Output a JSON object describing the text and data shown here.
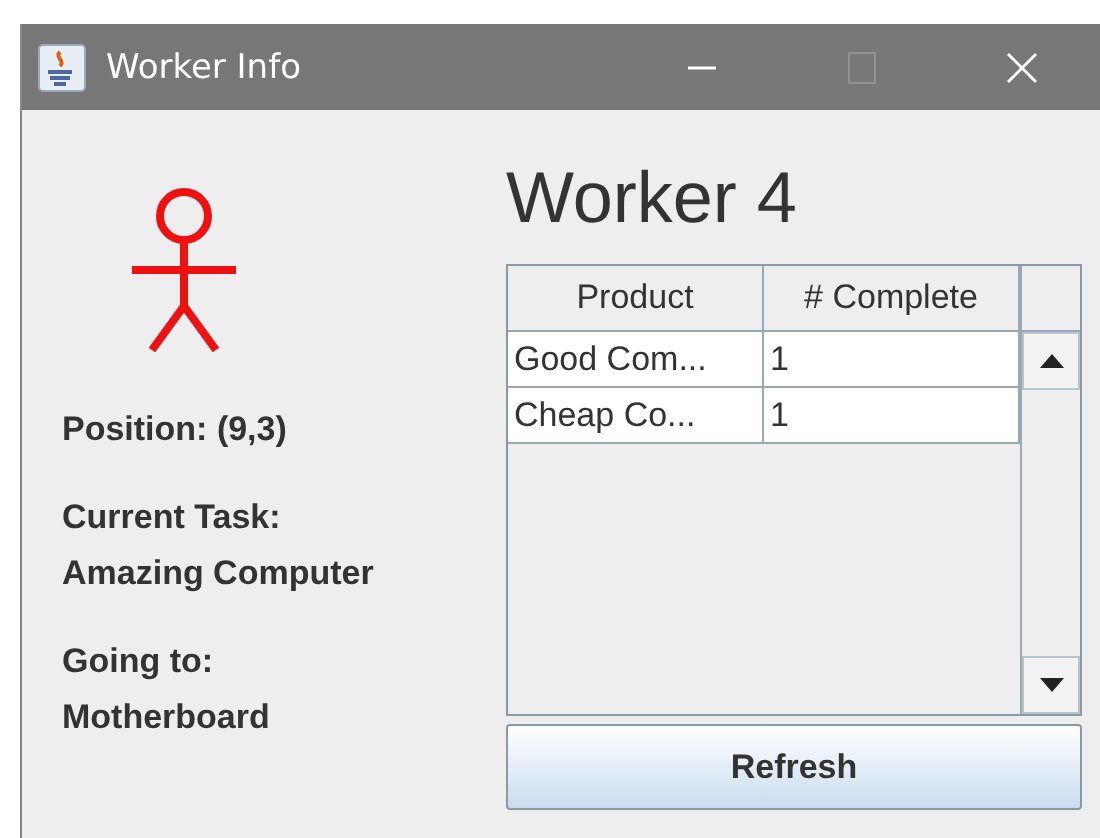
{
  "window": {
    "title": "Worker Info",
    "controls": [
      {
        "kind": "minimize",
        "disabled": false
      },
      {
        "kind": "maximize",
        "disabled": true
      },
      {
        "kind": "close",
        "disabled": false
      }
    ]
  },
  "info": [
    {
      "lines": [
        "Position: (9,3)"
      ]
    },
    {
      "lines": [
        "Current Task:",
        "Amazing Computer"
      ]
    },
    {
      "lines": [
        "Going to:",
        "Motherboard"
      ]
    }
  ],
  "heading": "Worker 4",
  "table": {
    "columns": [
      "Product",
      "# Complete"
    ],
    "rows": [
      [
        "Good Com...",
        "1"
      ],
      [
        "Cheap Co...",
        "1"
      ]
    ]
  },
  "refresh_button": "Refresh"
}
